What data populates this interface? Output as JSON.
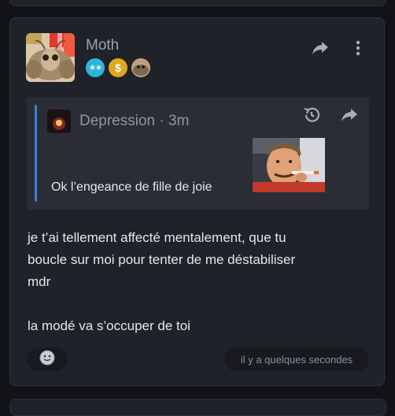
{
  "post": {
    "author": "Moth",
    "badges": [
      {
        "icon": "star-badge-icon",
        "text": "★★",
        "color": "#2cb5e0"
      },
      {
        "icon": "dollar-badge-icon",
        "text": "$",
        "color": "#e0a820"
      },
      {
        "icon": "moth-badge-icon",
        "color": "#8c7a64"
      }
    ],
    "actions": {
      "share_icon": "share-arrow-icon",
      "menu_icon": "more-vertical-icon"
    },
    "quote": {
      "author": "Depression",
      "separator": "·",
      "time": "3m",
      "text": "Ok l’engeance de fille de joie",
      "icons": {
        "history": "history-icon",
        "reply": "share-arrow-icon"
      }
    },
    "body_lines": [
      "je t’ai tellement affecté mentalement, que tu",
      "boucle sur moi pour tenter de me déstabiliser",
      "mdr",
      "",
      "la modé va s’occuper de toi"
    ],
    "timestamp": "il y a quelques secondes",
    "reaction_icon": "smiley-icon"
  },
  "colors": {
    "accent": "#3b82d6",
    "card": "#202229",
    "background": "#121318"
  }
}
